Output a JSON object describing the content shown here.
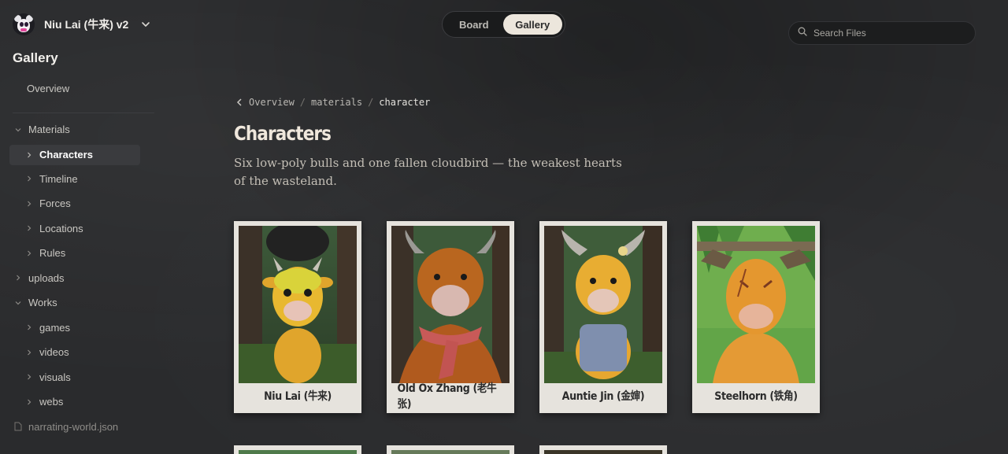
{
  "workspace": {
    "name": "Niu Lai (牛来) v2"
  },
  "sidebar": {
    "section_title": "Gallery",
    "overview_label": "Overview",
    "tree": [
      {
        "label": "Materials",
        "level": 0,
        "expanded": true
      },
      {
        "label": "Characters",
        "level": 1,
        "expanded": false,
        "active": true
      },
      {
        "label": "Timeline",
        "level": 1,
        "expanded": false
      },
      {
        "label": "Forces",
        "level": 1,
        "expanded": false
      },
      {
        "label": "Locations",
        "level": 1,
        "expanded": false
      },
      {
        "label": "Rules",
        "level": 1,
        "expanded": false
      },
      {
        "label": "uploads",
        "level": 0,
        "expanded": false
      },
      {
        "label": "Works",
        "level": 0,
        "expanded": true
      },
      {
        "label": "games",
        "level": 1,
        "expanded": false
      },
      {
        "label": "videos",
        "level": 1,
        "expanded": false
      },
      {
        "label": "visuals",
        "level": 1,
        "expanded": false
      },
      {
        "label": "webs",
        "level": 1,
        "expanded": false
      }
    ],
    "file_item": "narrating-world.json"
  },
  "view_toggle": {
    "board_label": "Board",
    "gallery_label": "Gallery",
    "active": "Gallery"
  },
  "search": {
    "placeholder": "Search Files",
    "value": ""
  },
  "breadcrumb": {
    "items": [
      "Overview",
      "materials",
      "character"
    ]
  },
  "page": {
    "title": "Characters",
    "description": "Six low-poly bulls and one fallen cloudbird — the weakest hearts of the wasteland."
  },
  "cards": [
    {
      "name": "Niu Lai (牛来)",
      "icon": "yellow-calf-portrait"
    },
    {
      "name": "Old Ox Zhang (老牛张)",
      "icon": "old-ox-scarf-portrait"
    },
    {
      "name": "Auntie Jin (金婶)",
      "icon": "auntie-overalls-portrait"
    },
    {
      "name": "Steelhorn (铁角)",
      "icon": "scarred-bull-portrait"
    }
  ],
  "colors": {
    "accent": "#ece6dc",
    "background": "#2a2b2d",
    "card": "#e6e3dd"
  }
}
